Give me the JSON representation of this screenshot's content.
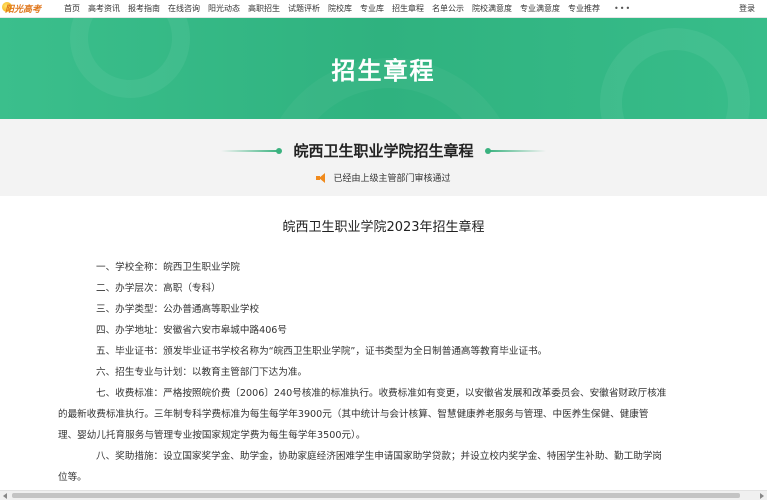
{
  "site": {
    "logo_text": "阳光高考"
  },
  "nav": {
    "items": [
      "首页",
      "高考资讯",
      "报考指南",
      "在线咨询",
      "阳光动态",
      "高职招生",
      "试题评析",
      "院校库",
      "专业库",
      "招生章程",
      "名单公示",
      "院校满意度",
      "专业满意度",
      "专业推荐"
    ],
    "more": "•••",
    "login": "登录"
  },
  "banner": {
    "title": "招生章程"
  },
  "doc": {
    "heading": "皖西卫生职业学院招生章程",
    "approval": "已经由上级主管部门审核通过",
    "title": "皖西卫生职业学院2023年招生章程",
    "lines": [
      "一、学校全称：皖西卫生职业学院",
      "二、办学层次：高职（专科）",
      "三、办学类型：公办普通高等职业学校",
      "四、办学地址：安徽省六安市皋城中路406号",
      "五、毕业证书：颁发毕业证书学校名称为“皖西卫生职业学院”，证书类型为全日制普通高等教育毕业证书。",
      "六、招生专业与计划：以教育主管部门下达为准。",
      "七、收费标准：严格按照皖价费〔2006〕240号核准的标准执行。收费标准如有变更，以安徽省发展和改革委员会、安徽省财政厅核准",
      "的最新收费标准执行。三年制专科学费标准为每生每学年3900元（其中统计与会计核算、智慧健康养老服务与管理、中医养生保健、健康管",
      "理、婴幼儿托育服务与管理专业按国家规定学费为每生每学年3500元）。",
      "八、奖助措施：设立国家奖学金、助学金，协助家庭经济困难学生申请国家助学贷款；并设立校内奖学金、特困学生补助、勤工助学岗",
      "位等。"
    ]
  },
  "colors": {
    "banner": "#2fb27f",
    "accent": "#3ab27f",
    "speaker": "#f08a1c"
  },
  "icons": {
    "logo": "sun-logo-icon",
    "speaker": "speaker-icon"
  }
}
